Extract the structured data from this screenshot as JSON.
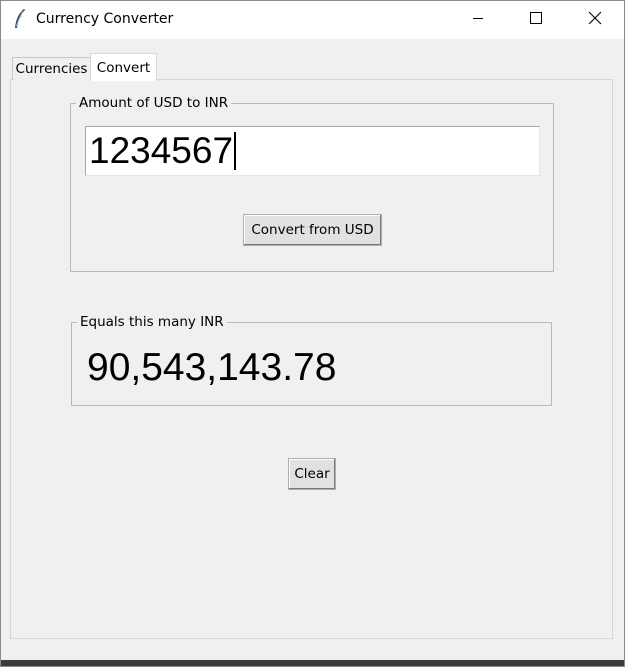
{
  "window": {
    "title": "Currency Converter"
  },
  "tabs": [
    {
      "label": "Currencies",
      "selected": false
    },
    {
      "label": "Convert",
      "selected": true
    }
  ],
  "amount_frame": {
    "label": "Amount of USD to INR",
    "entry_value": "1234567",
    "convert_button": "Convert from USD"
  },
  "result_frame": {
    "label": "Equals this many INR",
    "value": "90,543,143.78"
  },
  "clear_button": "Clear",
  "icons": {
    "app": "feather-icon",
    "minimize": "minimize-icon",
    "maximize": "maximize-icon",
    "close": "close-icon"
  }
}
